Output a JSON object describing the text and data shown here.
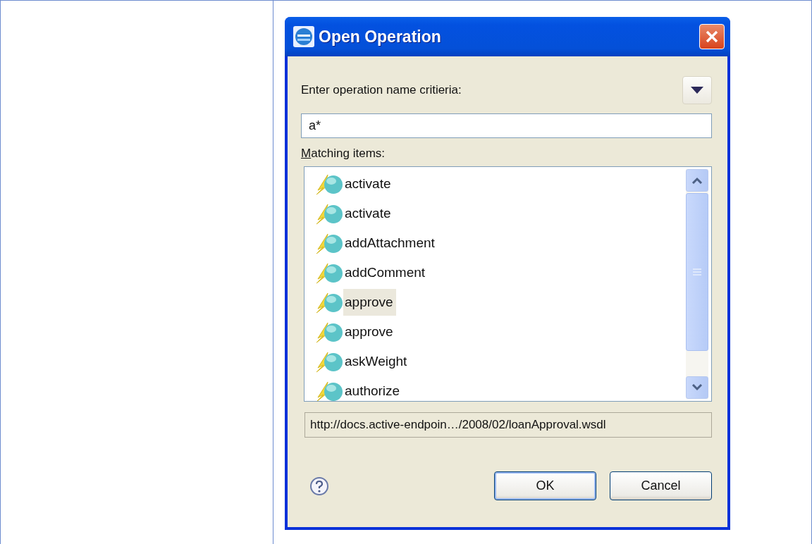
{
  "window": {
    "title": "Open Operation"
  },
  "criteria": {
    "label": "Enter operation name critieria:",
    "value": "a*"
  },
  "matching": {
    "label": "Matching items:",
    "mnemonic_underlined": true
  },
  "items": [
    {
      "name": "activate",
      "selected": false
    },
    {
      "name": "activate",
      "selected": false
    },
    {
      "name": "addAttachment",
      "selected": false
    },
    {
      "name": "addComment",
      "selected": false
    },
    {
      "name": "approve",
      "selected": true
    },
    {
      "name": "approve",
      "selected": false
    },
    {
      "name": "askWeight",
      "selected": false
    },
    {
      "name": "authorize",
      "selected": false
    }
  ],
  "location": "http://docs.active-endpoin…/2008/02/loanApproval.wsdl",
  "buttons": [
    {
      "label": "OK",
      "default": true
    },
    {
      "label": "Cancel",
      "default": false
    }
  ]
}
